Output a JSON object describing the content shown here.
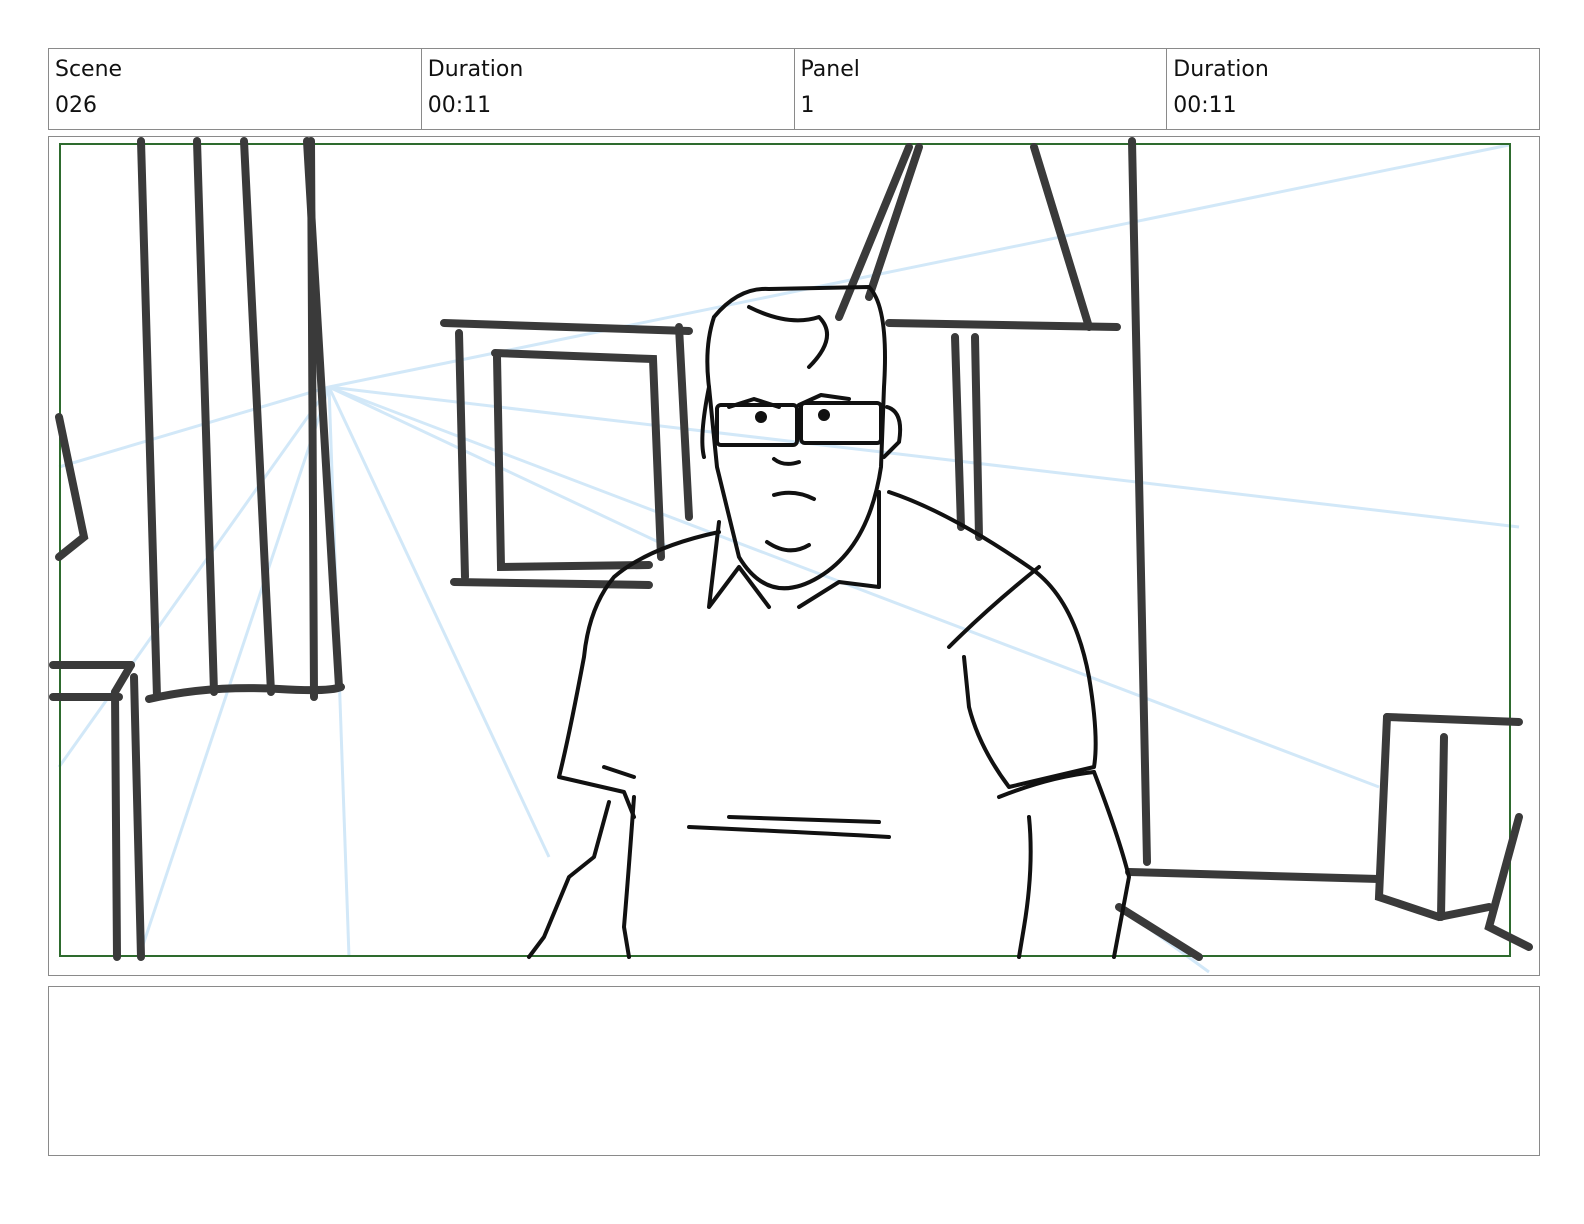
{
  "header": {
    "scene": {
      "label": "Scene",
      "value": "026"
    },
    "scene_duration": {
      "label": "Duration",
      "value": "00:11"
    },
    "panel": {
      "label": "Panel",
      "value": "1"
    },
    "panel_duration": {
      "label": "Duration",
      "value": "00:11"
    }
  },
  "notes": {
    "text": ""
  },
  "colors": {
    "safe_area": "#2e6b2e",
    "perspective_guides": "#cfe6f7",
    "ink": "#3a3a3a",
    "border": "#8a8a8a"
  },
  "sketch": {
    "description_icon": "storyboard-sketch-man-with-glasses"
  }
}
